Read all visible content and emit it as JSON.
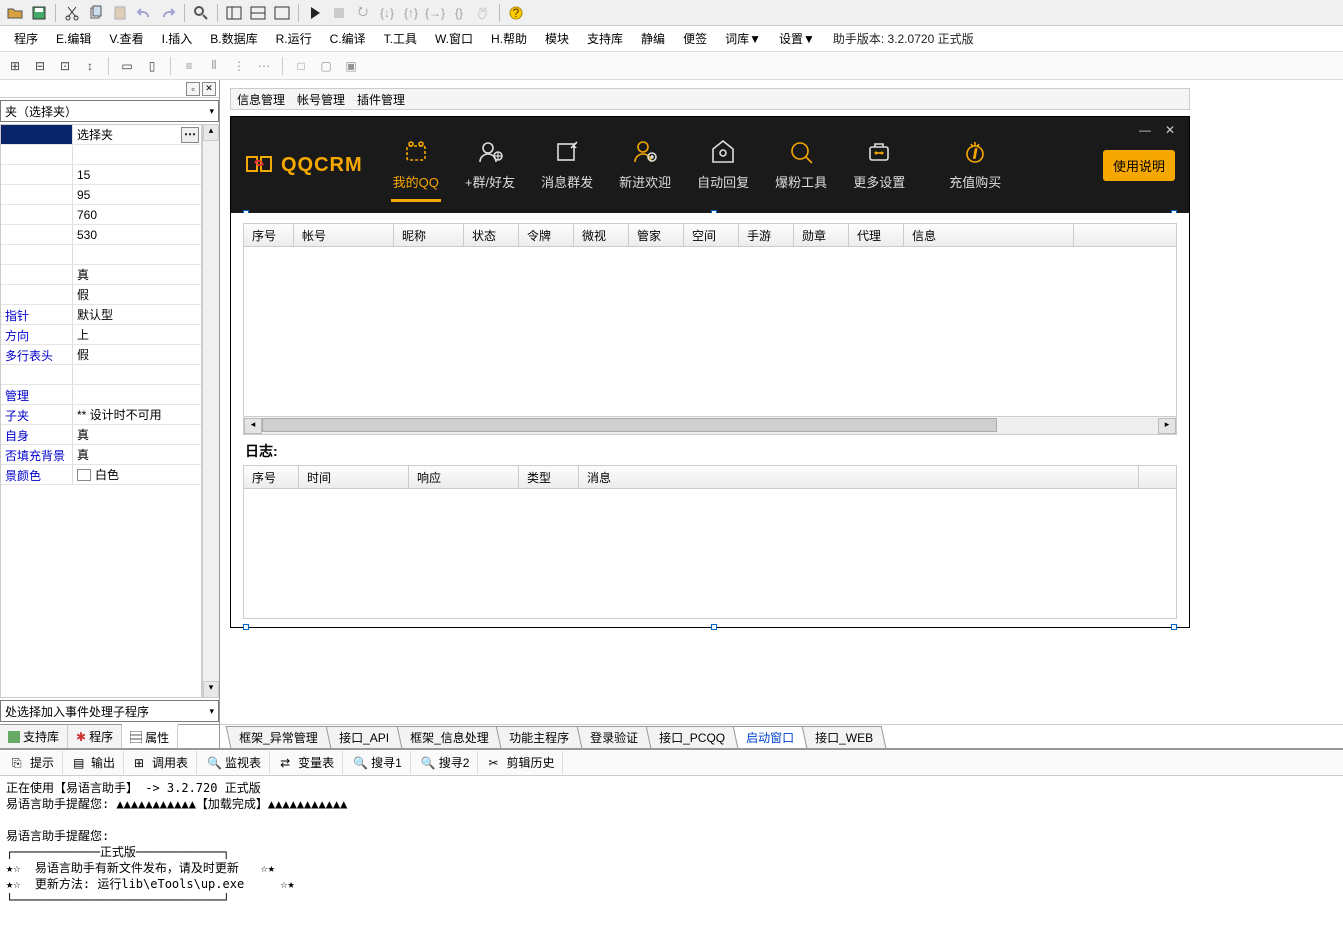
{
  "menus": [
    "程序",
    "E.编辑",
    "V.查看",
    "I.插入",
    "B.数据库",
    "R.运行",
    "C.编译",
    "T.工具",
    "W.窗口",
    "H.帮助",
    "模块",
    "支持库",
    "静编",
    "便签",
    "词库▼",
    "设置▼"
  ],
  "menu_right": "助手版本: 3.2.0720 正式版",
  "left": {
    "combo": "夹（选择夹）",
    "props": [
      {
        "name": "",
        "val": "选择夹",
        "first": true
      },
      {
        "name": "",
        "val": ""
      },
      {
        "name": "",
        "val": "15"
      },
      {
        "name": "",
        "val": "95"
      },
      {
        "name": "",
        "val": "760"
      },
      {
        "name": "",
        "val": "530"
      },
      {
        "name": "",
        "val": ""
      },
      {
        "name": "",
        "val": "真"
      },
      {
        "name": "",
        "val": "假"
      },
      {
        "name": "指针",
        "val": "默认型",
        "blue": true
      },
      {
        "name": "方向",
        "val": "上",
        "blue": true
      },
      {
        "name": "多行表头",
        "val": "假",
        "blue": true
      },
      {
        "name": "",
        "val": ""
      },
      {
        "name": "管理",
        "val": "",
        "blue": true
      },
      {
        "name": "子夹",
        "val": "** 设计时不可用",
        "blue": true
      },
      {
        "name": "自身",
        "val": "真",
        "blue": true
      },
      {
        "name": "否填充背景",
        "val": "真",
        "blue": true
      },
      {
        "name": "景颜色",
        "val": "白色",
        "blue": true,
        "swatch": true
      }
    ],
    "hint": "处选择加入事件处理子程序",
    "tabs": [
      "支持库",
      "程序",
      "属性"
    ]
  },
  "form_menu": [
    "信息管理",
    "帐号管理",
    "插件管理"
  ],
  "qq": {
    "logo": "QQCRM",
    "nav": [
      "我的QQ",
      "+群/好友",
      "消息群发",
      "新进欢迎",
      "自动回复",
      "爆粉工具",
      "更多设置",
      "充值购买"
    ],
    "btn": "使用说明",
    "table1": [
      "序号",
      "帐号",
      "昵称",
      "状态",
      "令牌",
      "微视",
      "管家",
      "空间",
      "手游",
      "勋章",
      "代理",
      "信息"
    ],
    "log": "日志:",
    "table2": [
      "序号",
      "时间",
      "响应",
      "类型",
      "消息"
    ]
  },
  "btabs": [
    "框架_异常管理",
    "接口_API",
    "框架_信息处理",
    "功能主程序",
    "登录验证",
    "接口_PCQQ",
    "启动窗口",
    "接口_WEB"
  ],
  "otabs": [
    "提示",
    "输出",
    "调用表",
    "监视表",
    "变量表",
    "搜寻1",
    "搜寻2",
    "剪辑历史"
  ],
  "out_lines": [
    "正在使用【易语言助手】 -> 3.2.720 正式版",
    "易语言助手提醒您: ▲▲▲▲▲▲▲▲▲▲▲【加载完成】▲▲▲▲▲▲▲▲▲▲▲",
    "",
    "易语言助手提醒您:",
    "┌────────────正式版────────────┐",
    "★☆  易语言助手有新文件发布，请及时更新   ☆★",
    "★☆  更新方法: 运行lib\\eTools\\up.exe     ☆★",
    "└─────────────────────────────┘"
  ]
}
